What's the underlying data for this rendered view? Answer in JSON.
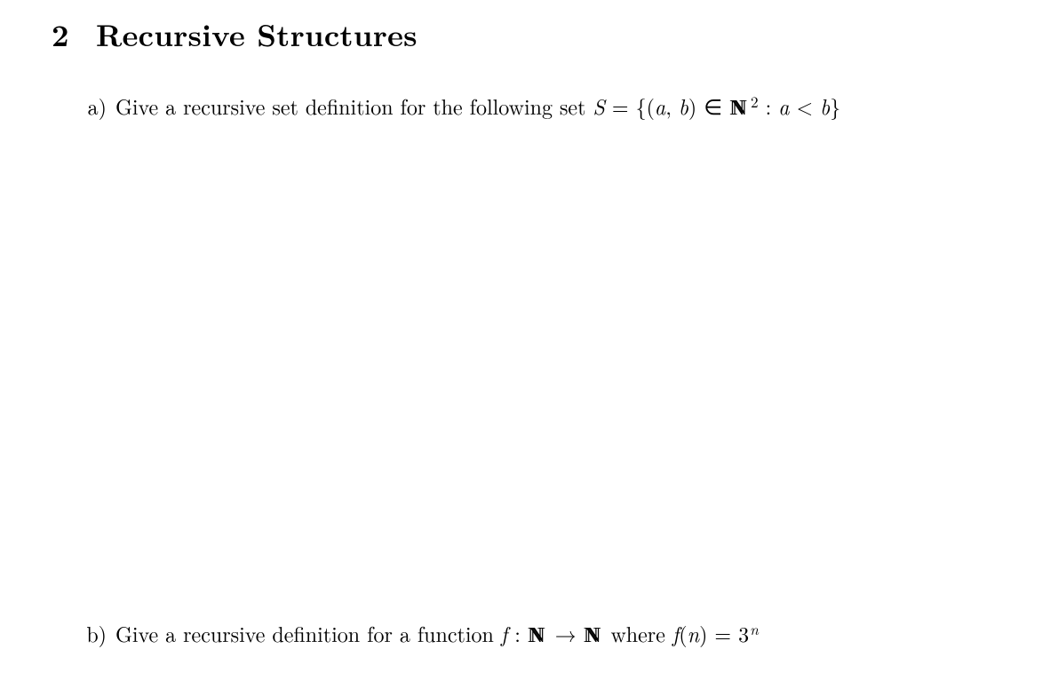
{
  "section": {
    "number": "2",
    "title": "Recursive Structures"
  },
  "items": {
    "a": {
      "label": "a)",
      "lead_text": "Give a recursive set definition for the following set ",
      "S": "S",
      "eq": " = ",
      "lbrace": "{",
      "lpar": "(",
      "avar": "a",
      "comma": ", ",
      "bvar": "b",
      "rpar": ")",
      "in": " ∈ ",
      "N": "N",
      "sq_exp": "2",
      "colon": " : ",
      "avar2": "a",
      "lt": " < ",
      "bvar2": "b",
      "rbrace": "}"
    },
    "b": {
      "label": "b)",
      "lead_text": "Give a recursive definition for a function ",
      "f": "f",
      "colon_map": " : ",
      "N1": "N",
      "arrow": " → ",
      "N2": "N",
      "where": " where ",
      "f2": "f",
      "lpar": "(",
      "nvar": "n",
      "rpar": ")",
      "eq": " = ",
      "base": "3",
      "exp": "n"
    }
  }
}
